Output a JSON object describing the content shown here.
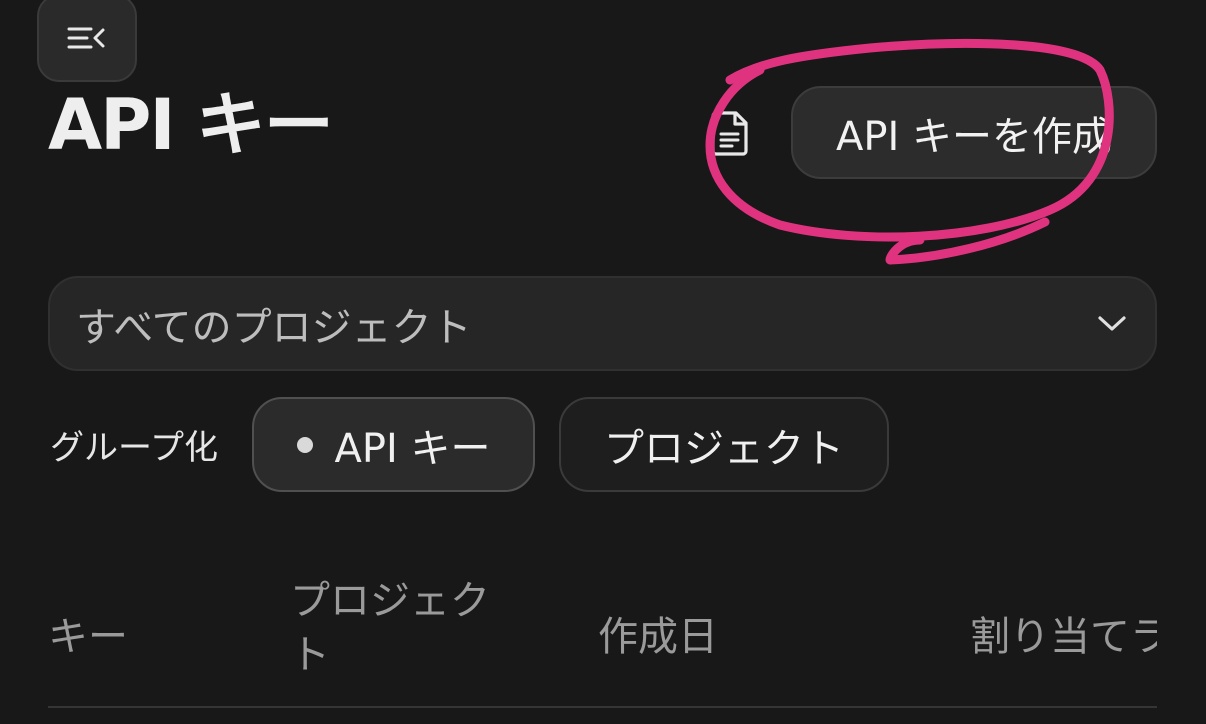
{
  "header": {
    "title": "API キー",
    "menu_icon": "sidebar-collapse-icon",
    "doc_icon": "document-icon",
    "create_button_label": "API キーを作成"
  },
  "filter": {
    "project_select_value": "すべてのプロジェクト",
    "chevron_icon": "chevron-down-icon"
  },
  "grouping": {
    "label": "グループ化",
    "options": [
      "API キー",
      "プロジェクト"
    ],
    "selected": "API キー"
  },
  "table": {
    "columns": [
      "キー",
      "プロジェクト",
      "作成日",
      "割り当てラ"
    ]
  },
  "annotation": {
    "color": "#e0337f"
  }
}
